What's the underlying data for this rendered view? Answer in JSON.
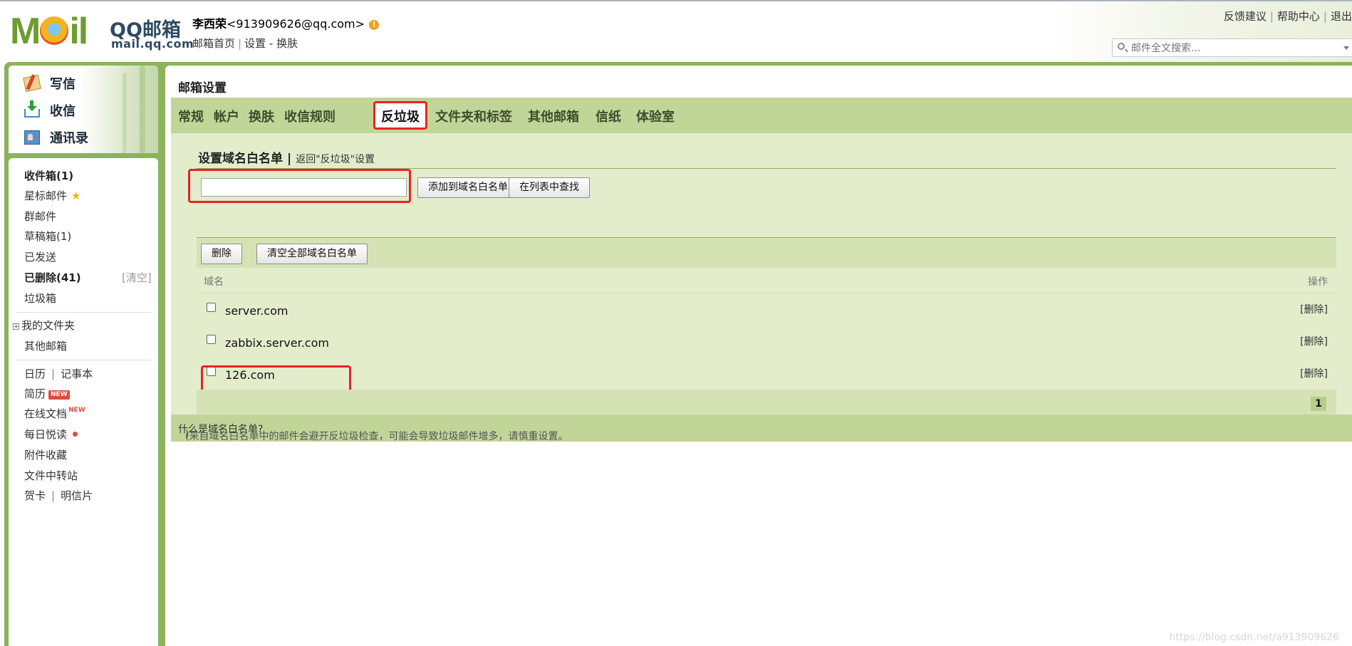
{
  "brand": {
    "logo_text": "M  il",
    "product": "QQ邮箱",
    "domain": "mail.qq.com"
  },
  "user": {
    "name": "李西荣",
    "email": "<913909626@qq.com>",
    "warn_icon": "!",
    "links": {
      "home": "邮箱首页",
      "settings": "设置",
      "dash": "-",
      "skin": "换肤"
    }
  },
  "top_links": {
    "feedback": "反馈建议",
    "help": "帮助中心",
    "logout": "退出"
  },
  "search": {
    "placeholder": "邮件全文搜索..."
  },
  "quick_actions": {
    "compose": "写信",
    "receive": "收信",
    "contacts": "通讯录"
  },
  "folders": {
    "inbox": "收件箱(1)",
    "starred": "星标邮件",
    "group": "群邮件",
    "drafts": "草稿箱(1)",
    "sent": "已发送",
    "deleted": "已删除(41)",
    "deleted_clear": "[清空]",
    "junk": "垃圾箱",
    "my_folders": "我的文件夹",
    "other_mailboxes": "其他邮箱",
    "calendar": "日历",
    "notebook": "记事本",
    "resume": "简历",
    "resume_badge": "NEW",
    "online_docs": "在线文档",
    "online_docs_badge": "NEW",
    "daily_read": "每日悦读",
    "attachments": "附件收藏",
    "file_transfer": "文件中转站",
    "greeting_card": "贺卡",
    "postcard": "明信片"
  },
  "settings": {
    "title": "邮箱设置",
    "tabs": [
      "常规",
      "帐户",
      "换肤",
      "收信规则",
      "反垃圾",
      "文件夹和标签",
      "其他邮箱",
      "信纸",
      "体验室"
    ],
    "active_tab": "反垃圾"
  },
  "whitelist": {
    "heading": "设置域名白名单",
    "separator": "|",
    "back_link": "返回\"反垃圾\"设置",
    "input_value": "",
    "add_button": "添加到域名白名单",
    "find_button": "在列表中查找",
    "delete_button": "删除",
    "clear_all_button": "清空全部域名白名单",
    "col_domain": "域名",
    "col_action": "操作",
    "rows": [
      {
        "domain": "server.com",
        "action": "[删除]"
      },
      {
        "domain": "zabbix.server.com",
        "action": "[删除]"
      },
      {
        "domain": "126.com",
        "action": "[删除]"
      }
    ],
    "page": "1"
  },
  "footer": {
    "note": "(来自域名白名单中的邮件会避开反垃圾检查，可能会导致垃圾邮件增多，请慎重设置。",
    "link": "什么是域名白名单?",
    "close": " )"
  },
  "watermark": "https://blog.csdn.net/a913909626",
  "colors": {
    "frame_green": "#8cb35c",
    "tab_green": "#c2d599",
    "content_green": "#e3edcc",
    "highlight_red": "#e82323"
  }
}
